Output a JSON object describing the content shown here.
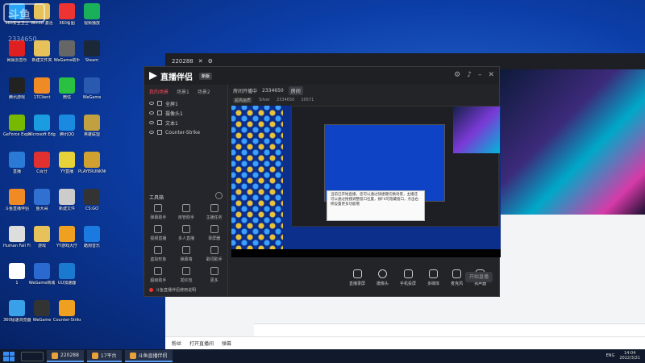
{
  "watermark": {
    "brand": "斗鱼",
    "room_id": "2334650"
  },
  "desktop_icons": [
    {
      "label": "360安全卫士",
      "color": "#2aa4f5"
    },
    {
      "label": "网易云音乐",
      "color": "#e02020"
    },
    {
      "label": "腾讯游戏",
      "color": "#222"
    },
    {
      "label": "GeForce Experience",
      "color": "#76b900"
    },
    {
      "label": "直播",
      "color": "#2a7ad6"
    },
    {
      "label": "斗鱼直播伴侣",
      "color": "#f08a24"
    },
    {
      "label": "Human Fall Flat",
      "color": "#ddd"
    },
    {
      "label": "1",
      "color": "#fff"
    },
    {
      "label": "360极速浏览器",
      "color": "#3aa0e8"
    },
    {
      "label": "Win10 激活",
      "color": "#e7c15a"
    },
    {
      "label": "新建文件夹",
      "color": "#e7c15a"
    },
    {
      "label": "17Client",
      "color": "#f08a24"
    },
    {
      "label": "Microsoft Edge",
      "color": "#1a9ce0"
    },
    {
      "label": "C百分",
      "color": "#e03030"
    },
    {
      "label": "鱼大哥",
      "color": "#3070d0"
    },
    {
      "label": "游戏",
      "color": "#e7c15a"
    },
    {
      "label": "WeGame商城",
      "color": "#2a6ad0"
    },
    {
      "label": "WeGame",
      "color": "#333"
    },
    {
      "label": "360看图",
      "color": "#e33"
    },
    {
      "label": "WeGame助手",
      "color": "#666"
    },
    {
      "label": "微信",
      "color": "#2ac042"
    },
    {
      "label": "腾讯QQ",
      "color": "#1a8ae0"
    },
    {
      "label": "YY直播",
      "color": "#e8d23a"
    },
    {
      "label": "新建文件",
      "color": "#ccc"
    },
    {
      "label": "YY游戏大厅",
      "color": "#f0a020"
    },
    {
      "label": "UU加速器",
      "color": "#1a7ad0"
    },
    {
      "label": "Counter-Strike",
      "color": "#f0a020"
    },
    {
      "label": "视频播放",
      "color": "#1ab05a"
    },
    {
      "label": "Steam",
      "color": "#1b2838"
    },
    {
      "label": "WeGame",
      "color": "#2a5ab0"
    },
    {
      "label": "英雄联盟",
      "color": "#c0a040"
    },
    {
      "label": "PLAYERUNKNOWN'S BATTLEGROUNDS",
      "color": "#d0a030"
    },
    {
      "label": "CS:GO",
      "color": "#333"
    },
    {
      "label": "酷狗音乐",
      "color": "#1a7ae0"
    }
  ],
  "browser": {
    "top_items": [
      "220288",
      "✕",
      "⚙"
    ],
    "bottom_items": [
      "粉丝",
      "打开直播间",
      "弹幕"
    ]
  },
  "app": {
    "title": "直播伴侣",
    "version_badge": "新版",
    "tabs": [
      "我的场景",
      "场景1",
      "场景2"
    ],
    "sources": [
      "全屏1",
      "摄像头1",
      "文本1",
      "Counter-Strike"
    ],
    "tools_title": "工具箱",
    "tools": [
      "弹幕助手",
      "房管助手",
      "主播任务",
      "视频直播",
      "多人直播",
      "录屏器",
      "虚拟形象",
      "弹幕墙",
      "歌词助手",
      "超级助手",
      "发红包",
      "更多"
    ],
    "warning": "斗鱼直播伴侣使用说明",
    "info_title": "房间开播中",
    "room_id": "2334650",
    "room_btn": "房间",
    "info_tags": [
      "超高画质",
      "Silver",
      "2334650",
      "10571"
    ],
    "tooltip_text": "当前已开始直播，您可以通过快捷键切换场景，主播还可以通过拖拽调整窗口位置，按F4可隐藏窗口，点击右侧设置更多功能哦",
    "controls": [
      {
        "label": "直播录屏",
        "round": false
      },
      {
        "label": "摄像头",
        "round": true
      },
      {
        "label": "手机投屏",
        "round": false
      },
      {
        "label": "多媒体",
        "round": false
      },
      {
        "label": "麦克风",
        "round": false
      },
      {
        "label": "扬声器",
        "round": false
      }
    ],
    "live_button": "开始直播"
  },
  "taskbar": {
    "tasks": [
      "220288",
      "17平台",
      "斗鱼直播伴侣"
    ],
    "tray": [
      "ENG"
    ],
    "time": "14:04",
    "date": "2022/3/21"
  }
}
